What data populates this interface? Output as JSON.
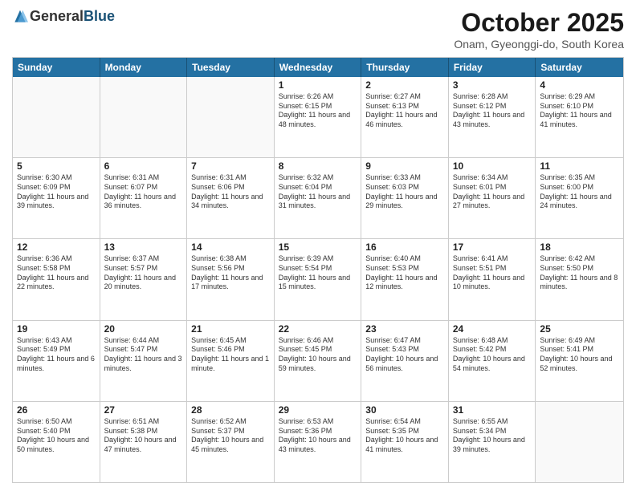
{
  "logo": {
    "general": "General",
    "blue": "Blue"
  },
  "title": "October 2025",
  "subtitle": "Onam, Gyeonggi-do, South Korea",
  "days_of_week": [
    "Sunday",
    "Monday",
    "Tuesday",
    "Wednesday",
    "Thursday",
    "Friday",
    "Saturday"
  ],
  "rows": [
    [
      {
        "day": "",
        "info": ""
      },
      {
        "day": "",
        "info": ""
      },
      {
        "day": "",
        "info": ""
      },
      {
        "day": "1",
        "info": "Sunrise: 6:26 AM\nSunset: 6:15 PM\nDaylight: 11 hours\nand 48 minutes."
      },
      {
        "day": "2",
        "info": "Sunrise: 6:27 AM\nSunset: 6:13 PM\nDaylight: 11 hours\nand 46 minutes."
      },
      {
        "day": "3",
        "info": "Sunrise: 6:28 AM\nSunset: 6:12 PM\nDaylight: 11 hours\nand 43 minutes."
      },
      {
        "day": "4",
        "info": "Sunrise: 6:29 AM\nSunset: 6:10 PM\nDaylight: 11 hours\nand 41 minutes."
      }
    ],
    [
      {
        "day": "5",
        "info": "Sunrise: 6:30 AM\nSunset: 6:09 PM\nDaylight: 11 hours\nand 39 minutes."
      },
      {
        "day": "6",
        "info": "Sunrise: 6:31 AM\nSunset: 6:07 PM\nDaylight: 11 hours\nand 36 minutes."
      },
      {
        "day": "7",
        "info": "Sunrise: 6:31 AM\nSunset: 6:06 PM\nDaylight: 11 hours\nand 34 minutes."
      },
      {
        "day": "8",
        "info": "Sunrise: 6:32 AM\nSunset: 6:04 PM\nDaylight: 11 hours\nand 31 minutes."
      },
      {
        "day": "9",
        "info": "Sunrise: 6:33 AM\nSunset: 6:03 PM\nDaylight: 11 hours\nand 29 minutes."
      },
      {
        "day": "10",
        "info": "Sunrise: 6:34 AM\nSunset: 6:01 PM\nDaylight: 11 hours\nand 27 minutes."
      },
      {
        "day": "11",
        "info": "Sunrise: 6:35 AM\nSunset: 6:00 PM\nDaylight: 11 hours\nand 24 minutes."
      }
    ],
    [
      {
        "day": "12",
        "info": "Sunrise: 6:36 AM\nSunset: 5:58 PM\nDaylight: 11 hours\nand 22 minutes."
      },
      {
        "day": "13",
        "info": "Sunrise: 6:37 AM\nSunset: 5:57 PM\nDaylight: 11 hours\nand 20 minutes."
      },
      {
        "day": "14",
        "info": "Sunrise: 6:38 AM\nSunset: 5:56 PM\nDaylight: 11 hours\nand 17 minutes."
      },
      {
        "day": "15",
        "info": "Sunrise: 6:39 AM\nSunset: 5:54 PM\nDaylight: 11 hours\nand 15 minutes."
      },
      {
        "day": "16",
        "info": "Sunrise: 6:40 AM\nSunset: 5:53 PM\nDaylight: 11 hours\nand 12 minutes."
      },
      {
        "day": "17",
        "info": "Sunrise: 6:41 AM\nSunset: 5:51 PM\nDaylight: 11 hours\nand 10 minutes."
      },
      {
        "day": "18",
        "info": "Sunrise: 6:42 AM\nSunset: 5:50 PM\nDaylight: 11 hours\nand 8 minutes."
      }
    ],
    [
      {
        "day": "19",
        "info": "Sunrise: 6:43 AM\nSunset: 5:49 PM\nDaylight: 11 hours\nand 6 minutes."
      },
      {
        "day": "20",
        "info": "Sunrise: 6:44 AM\nSunset: 5:47 PM\nDaylight: 11 hours\nand 3 minutes."
      },
      {
        "day": "21",
        "info": "Sunrise: 6:45 AM\nSunset: 5:46 PM\nDaylight: 11 hours\nand 1 minute."
      },
      {
        "day": "22",
        "info": "Sunrise: 6:46 AM\nSunset: 5:45 PM\nDaylight: 10 hours\nand 59 minutes."
      },
      {
        "day": "23",
        "info": "Sunrise: 6:47 AM\nSunset: 5:43 PM\nDaylight: 10 hours\nand 56 minutes."
      },
      {
        "day": "24",
        "info": "Sunrise: 6:48 AM\nSunset: 5:42 PM\nDaylight: 10 hours\nand 54 minutes."
      },
      {
        "day": "25",
        "info": "Sunrise: 6:49 AM\nSunset: 5:41 PM\nDaylight: 10 hours\nand 52 minutes."
      }
    ],
    [
      {
        "day": "26",
        "info": "Sunrise: 6:50 AM\nSunset: 5:40 PM\nDaylight: 10 hours\nand 50 minutes."
      },
      {
        "day": "27",
        "info": "Sunrise: 6:51 AM\nSunset: 5:38 PM\nDaylight: 10 hours\nand 47 minutes."
      },
      {
        "day": "28",
        "info": "Sunrise: 6:52 AM\nSunset: 5:37 PM\nDaylight: 10 hours\nand 45 minutes."
      },
      {
        "day": "29",
        "info": "Sunrise: 6:53 AM\nSunset: 5:36 PM\nDaylight: 10 hours\nand 43 minutes."
      },
      {
        "day": "30",
        "info": "Sunrise: 6:54 AM\nSunset: 5:35 PM\nDaylight: 10 hours\nand 41 minutes."
      },
      {
        "day": "31",
        "info": "Sunrise: 6:55 AM\nSunset: 5:34 PM\nDaylight: 10 hours\nand 39 minutes."
      },
      {
        "day": "",
        "info": ""
      }
    ]
  ]
}
